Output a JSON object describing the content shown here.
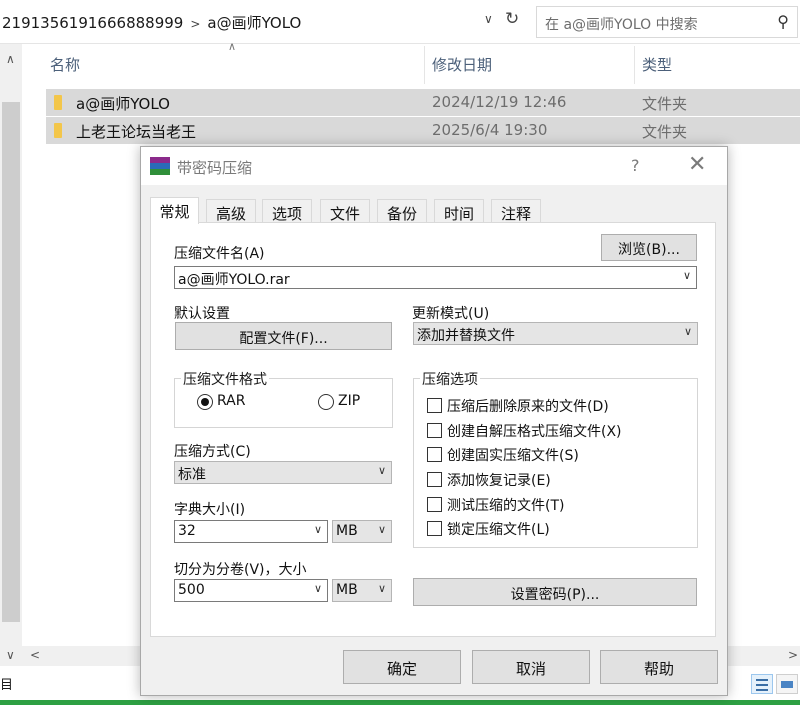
{
  "explorer": {
    "breadcrumb": [
      "2191356191666888999",
      "a@画师YOLO"
    ],
    "search_placeholder": "在 a@画师YOLO 中搜索",
    "columns": {
      "name": "名称",
      "modified": "修改日期",
      "type": "类型"
    },
    "files": [
      {
        "name": "a@画师YOLO",
        "modified": "2024/12/19 12:46",
        "type": "文件夹"
      },
      {
        "name": "上老王论坛当老王",
        "modified": "2025/6/4 19:30",
        "type": "文件夹"
      }
    ],
    "status_text": "目"
  },
  "dialog": {
    "title": "带密码压缩",
    "help_glyph": "?",
    "close_glyph": "✕",
    "tabs": [
      "常规",
      "高级",
      "选项",
      "文件",
      "备份",
      "时间",
      "注释"
    ],
    "active_tab": "常规",
    "archive_name_label": "压缩文件名(A)",
    "browse_button": "浏览(B)...",
    "archive_name_value": "a@画师YOLO.rar",
    "default_settings_label": "默认设置",
    "profiles_button": "配置文件(F)...",
    "update_mode_label": "更新模式(U)",
    "update_mode_value": "添加并替换文件",
    "format_group_title": "压缩文件格式",
    "format_rar": "RAR",
    "format_zip": "ZIP",
    "selected_format": "RAR",
    "options_group_title": "压缩选项",
    "options": [
      {
        "label": "压缩后删除原来的文件(D)",
        "checked": false
      },
      {
        "label": "创建自解压格式压缩文件(X)",
        "checked": false
      },
      {
        "label": "创建固实压缩文件(S)",
        "checked": false
      },
      {
        "label": "添加恢复记录(E)",
        "checked": false
      },
      {
        "label": "测试压缩的文件(T)",
        "checked": false
      },
      {
        "label": "锁定压缩文件(L)",
        "checked": false
      }
    ],
    "method_label": "压缩方式(C)",
    "method_value": "标准",
    "dict_label": "字典大小(I)",
    "dict_value": "32",
    "dict_unit": "MB",
    "split_label": "切分为分卷(V)，大小",
    "split_value": "500",
    "split_unit": "MB",
    "set_password_button": "设置密码(P)...",
    "ok_button": "确定",
    "cancel_button": "取消",
    "help_button": "帮助"
  },
  "colors": {
    "selection": "#d9d9d9",
    "folder": "#f3c64a",
    "dialog_bg": "#f0f0f0",
    "accent_green": "#2ea043"
  }
}
